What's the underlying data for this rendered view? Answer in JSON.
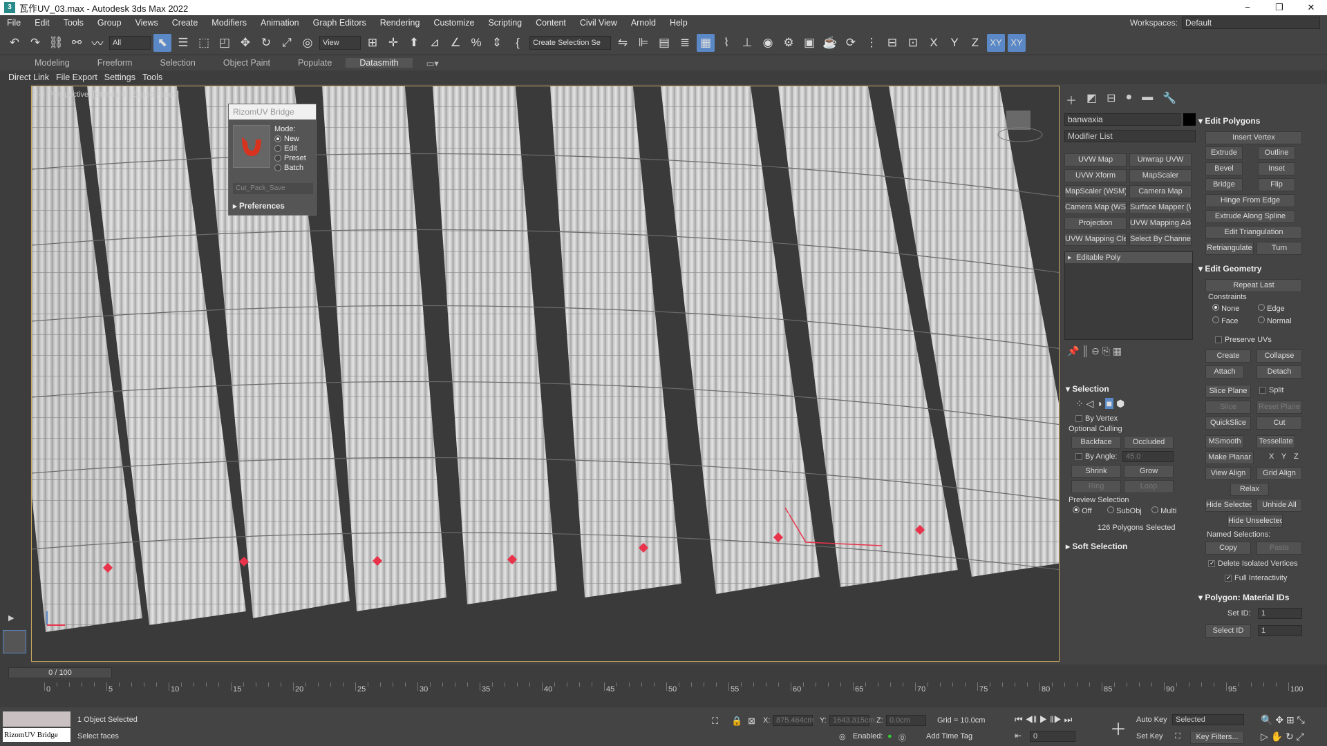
{
  "title": "瓦作UV_03.max - Autodesk 3ds Max 2022",
  "window_buttons": [
    "−",
    "❐",
    "✕"
  ],
  "menu": [
    "File",
    "Edit",
    "Tools",
    "Group",
    "Views",
    "Create",
    "Modifiers",
    "Animation",
    "Graph Editors",
    "Rendering",
    "Customize",
    "Scripting",
    "Content",
    "Civil View",
    "Arnold",
    "Help"
  ],
  "workspace": {
    "label": "Workspaces:",
    "value": "Default"
  },
  "toolbar": {
    "filter": "All",
    "view": "View",
    "create_selection_set": "Create Selection Se",
    "axis_x": "X",
    "axis_y": "Y",
    "axis_z": "Z",
    "axis_xy": "XY",
    "axis_xy2": "XY"
  },
  "ribbon_tabs": [
    "Modeling",
    "Freeform",
    "Selection",
    "Object Paint",
    "Populate",
    "Datasmith"
  ],
  "active_ribbon_tab": "Datasmith",
  "sub_menu": [
    "Direct Link",
    "File Export",
    "Settings",
    "Tools"
  ],
  "viewport": {
    "label": "[+] [Perspective] [Standard] [Edged Faces]"
  },
  "rizom": {
    "title": "RizomUV Bridge",
    "mode_label": "Mode:",
    "modes": [
      "New",
      "Edit",
      "Preset",
      "Batch"
    ],
    "selected_mode": "New",
    "preset_value": "Cut_Pack_Save",
    "preferences": "Preferences"
  },
  "command_panel": {
    "object_name": "banwaxia",
    "modifier_list": "Modifier List",
    "modifier_buttons": [
      "UVW Map",
      "Unwrap UVW",
      "UVW Xform",
      "MapScaler",
      "MapScaler (WSM)",
      "Camera Map",
      "Camera Map (WSM)",
      "Surface Mapper (WSM)",
      "Projection",
      "UVW Mapping Add",
      "UVW Mapping Clear",
      "Select By Channel"
    ],
    "stack_item": "Editable Poly",
    "selection": {
      "header": "Selection",
      "by_vertex": "By Vertex",
      "optional_culling": "Optional Culling",
      "backface": "Backface",
      "occluded": "Occluded",
      "by_angle": "By Angle:",
      "by_angle_value": "45.0",
      "shrink": "Shrink",
      "grow": "Grow",
      "ring": "Ring",
      "loop": "Loop",
      "preview_selection": "Preview Selection",
      "preview_options": [
        "Off",
        "SubObj",
        "Multi"
      ],
      "status": "126 Polygons Selected"
    },
    "soft_selection": "Soft Selection",
    "edit_polygons": {
      "header": "Edit Polygons",
      "insert_vertex": "Insert Vertex",
      "extrude": "Extrude",
      "outline": "Outline",
      "bevel": "Bevel",
      "inset": "Inset",
      "bridge": "Bridge",
      "flip": "Flip",
      "hinge": "Hinge From Edge",
      "extrude_spline": "Extrude Along Spline",
      "edit_triangulation": "Edit Triangulation",
      "retriangulate": "Retriangulate",
      "turn": "Turn"
    },
    "edit_geometry": {
      "header": "Edit Geometry",
      "repeat_last": "Repeat Last",
      "constraints": "Constraints",
      "constraint_options": [
        "None",
        "Edge",
        "Face",
        "Normal"
      ],
      "preserve_uvs": "Preserve UVs",
      "create": "Create",
      "collapse": "Collapse",
      "attach": "Attach",
      "detach": "Detach",
      "slice_plane": "Slice Plane",
      "split": "Split",
      "slice": "Slice",
      "reset_plane": "Reset Plane",
      "quickslice": "QuickSlice",
      "cut": "Cut",
      "msmooth": "MSmooth",
      "tessellate": "Tessellate",
      "make_planar": "Make Planar",
      "x": "X",
      "y": "Y",
      "z": "Z",
      "view_align": "View Align",
      "grid_align": "Grid Align",
      "relax": "Relax",
      "hide_selected": "Hide Selected",
      "unhide_all": "Unhide All",
      "hide_unselected": "Hide Unselected",
      "named_selections": "Named Selections:",
      "copy": "Copy",
      "paste": "Paste",
      "delete_isolated": "Delete Isolated Vertices",
      "full_interactivity": "Full Interactivity"
    },
    "material_ids": {
      "header": "Polygon: Material IDs",
      "set_id": "Set ID:",
      "set_id_value": "1",
      "select_id": "Select ID",
      "select_id_value": "1"
    }
  },
  "timeline": {
    "frame": "0 / 100",
    "ticks": [
      "0",
      "5",
      "10",
      "15",
      "20",
      "25",
      "30",
      "35",
      "40",
      "45",
      "50",
      "55",
      "60",
      "65",
      "70",
      "75",
      "80",
      "85",
      "90",
      "95",
      "100"
    ]
  },
  "status": {
    "maxscript": "RizomUV Bridge",
    "objects": "1 Object Selected",
    "prompt": "Select faces",
    "x_label": "X:",
    "x_value": "875.464cm",
    "y_label": "Y:",
    "y_value": "1643.315cm",
    "z_label": "Z:",
    "z_value": "0.0cm",
    "grid": "Grid = 10.0cm",
    "enabled": "Enabled:",
    "add_time_tag": "Add Time Tag",
    "auto_key": "Auto Key",
    "selected": "Selected",
    "set_key": "Set Key",
    "key_filters": "Key Filters...",
    "frame_value": "0"
  },
  "colors": {
    "accent": "#5b88c6",
    "viewport_border": "#c9a85e",
    "selection": "#e8334a"
  }
}
